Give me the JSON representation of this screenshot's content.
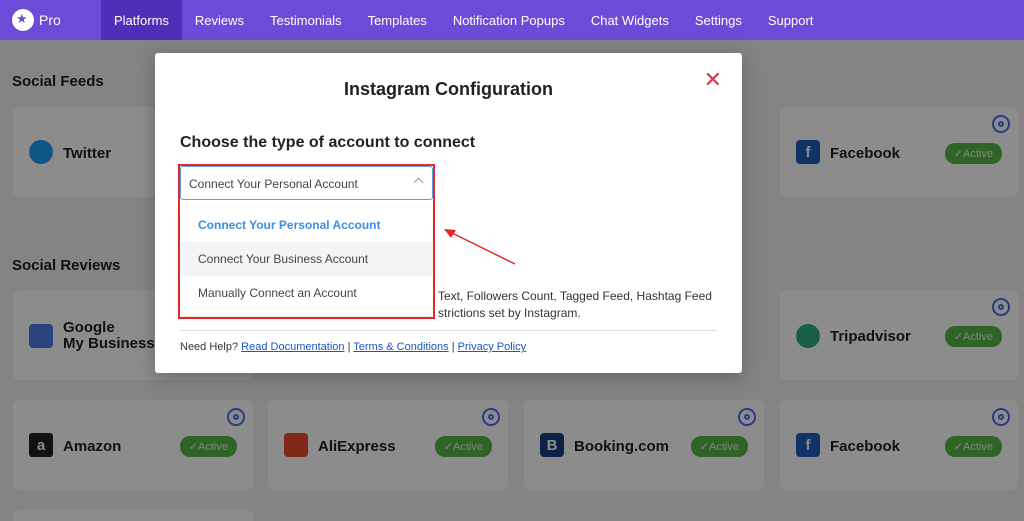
{
  "brand": {
    "name": "Pro"
  },
  "nav": {
    "items": [
      "Platforms",
      "Reviews",
      "Testimonials",
      "Templates",
      "Notification Popups",
      "Chat Widgets",
      "Settings",
      "Support"
    ],
    "active": "Platforms"
  },
  "sections": {
    "social_feeds": "Social Feeds",
    "social_reviews": "Social Reviews"
  },
  "cards": {
    "twitter": "Twitter",
    "facebook_feed": "Facebook",
    "google": "Google\nMy Business",
    "tripadvisor": "Tripadvisor",
    "amazon": "Amazon",
    "aliexpress": "AliExpress",
    "booking": "Booking.com",
    "facebook_review": "Facebook",
    "active_label": "Active"
  },
  "modal": {
    "title": "Instagram Configuration",
    "close_icon": "close-icon",
    "choose_label": "Choose the type of account to connect",
    "select_value": "Connect Your Personal Account",
    "options": [
      "Connect Your Personal Account",
      "Connect Your Business Account",
      "Manually Connect an Account"
    ],
    "desc_line1": "Text, Followers Count, Tagged Feed, Hashtag Feed",
    "desc_line2": "strictions set by Instagram.",
    "help_prefix": "Need Help?",
    "help_links": [
      "Read Documentation",
      "Terms & Conditions",
      "Privacy Policy"
    ],
    "separator": "|"
  },
  "colors": {
    "nav_bg": "#6c4bd8",
    "nav_active": "#4f2fb8",
    "active_badge": "#58b646",
    "highlight_red": "#e02a2a",
    "link": "#1a56c4"
  }
}
